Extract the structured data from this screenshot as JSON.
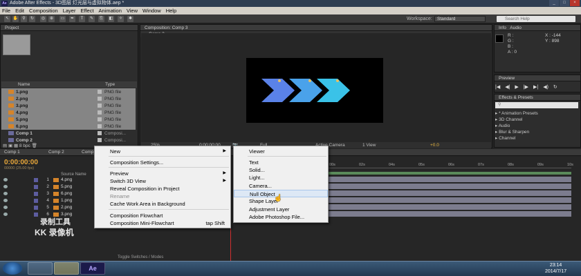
{
  "window": {
    "title": "Adobe After Effects - 3D图层 灯光层与虚拟物体.aep *",
    "app_badge": "Ae"
  },
  "menu": [
    "File",
    "Edit",
    "Composition",
    "Layer",
    "Effect",
    "Animation",
    "View",
    "Window",
    "Help"
  ],
  "workspace": {
    "label": "Workspace:",
    "value": "Standard",
    "search_placeholder": "Search Help"
  },
  "project": {
    "tab": "Project",
    "col_name": "Name",
    "col_type": "Type",
    "items": [
      {
        "name": "1.png",
        "type": "PNG file",
        "selected": true,
        "kind": "file"
      },
      {
        "name": "2.png",
        "type": "PNG file",
        "selected": true,
        "kind": "file"
      },
      {
        "name": "3.png",
        "type": "PNG file",
        "selected": true,
        "kind": "file"
      },
      {
        "name": "4.png",
        "type": "PNG file",
        "selected": true,
        "kind": "file"
      },
      {
        "name": "5.png",
        "type": "PNG file",
        "selected": true,
        "kind": "file"
      },
      {
        "name": "6.png",
        "type": "PNG file",
        "selected": true,
        "kind": "file"
      },
      {
        "name": "Comp 1",
        "type": "Composi...",
        "selected": false,
        "kind": "comp"
      },
      {
        "name": "Comp 2",
        "type": "Composi...",
        "selected": false,
        "kind": "comp"
      }
    ],
    "bpc": "8 bpc"
  },
  "composition": {
    "tab": "Composition: Comp 3",
    "subtab": "Comp 3",
    "zoom": "25%",
    "timecode": "0:00:00:00",
    "resolution": "Full",
    "camera": "Active Camera",
    "view": "1 View",
    "exposure": "+0.0",
    "arrow_colors": [
      "#5a82e8",
      "#4aa2ea",
      "#3ac2e8"
    ]
  },
  "info": {
    "tab": "Info",
    "tab2": "Audio",
    "r": "R :",
    "g": "G :",
    "b": "B :",
    "a": "A : 0",
    "x": "X : -144",
    "y": "Y : 898"
  },
  "preview": {
    "tab": "Preview",
    "buttons": [
      "|◀",
      "◀|",
      "▶",
      "|▶",
      "▶|",
      "◀)",
      "↻"
    ]
  },
  "effects": {
    "tab": "Effects & Presets",
    "items": [
      "* Animation Presets",
      "3D Channel",
      "Audio",
      "Blur & Sharpen",
      "Channel"
    ]
  },
  "timeline": {
    "tabs": [
      "Comp 1",
      "Comp 2",
      "Comp 3"
    ],
    "timecode": "0:00:00:00",
    "fps": "00000 (25.00 fps)",
    "col_source": "Source Name",
    "ruler": [
      "00s",
      "02s",
      "04s",
      "05s",
      "06s",
      "07s",
      "08s",
      "09s",
      "10s"
    ],
    "layers": [
      {
        "num": "1",
        "name": "4.png"
      },
      {
        "num": "2",
        "name": "5.png"
      },
      {
        "num": "3",
        "name": "6.png"
      },
      {
        "num": "4",
        "name": "1.png"
      },
      {
        "num": "5",
        "name": "2.png"
      },
      {
        "num": "6",
        "name": "3.png"
      }
    ],
    "toggle_label": "Toggle Switches / Modes"
  },
  "context_menu": {
    "items": [
      {
        "label": "New",
        "arrow": true
      },
      {
        "label": "Composition Settings..."
      },
      {
        "label": "Preview",
        "arrow": true
      },
      {
        "label": "Switch 3D View",
        "arrow": true
      },
      {
        "label": "Reveal Composition in Project"
      },
      {
        "label": "Rename",
        "disabled": true
      },
      {
        "label": "Cache Work Area in Background"
      },
      {
        "label": "Composition Flowchart"
      },
      {
        "label": "Composition Mini-Flowchart",
        "shortcut": "tap Shift"
      }
    ]
  },
  "submenu": {
    "items": [
      {
        "label": "Viewer"
      },
      {
        "label": "Text"
      },
      {
        "label": "Solid..."
      },
      {
        "label": "Light..."
      },
      {
        "label": "Camera..."
      },
      {
        "label": "Null Object",
        "highlighted": true
      },
      {
        "label": "Shape Layer"
      },
      {
        "label": "Adjustment Layer"
      },
      {
        "label": "Adobe Photoshop File..."
      }
    ]
  },
  "watermark": {
    "line1": "录制工具",
    "line2": "KK 录像机"
  },
  "taskbar": {
    "time": "23:14",
    "date": "2014/7/17",
    "ae_label": "Ae"
  }
}
